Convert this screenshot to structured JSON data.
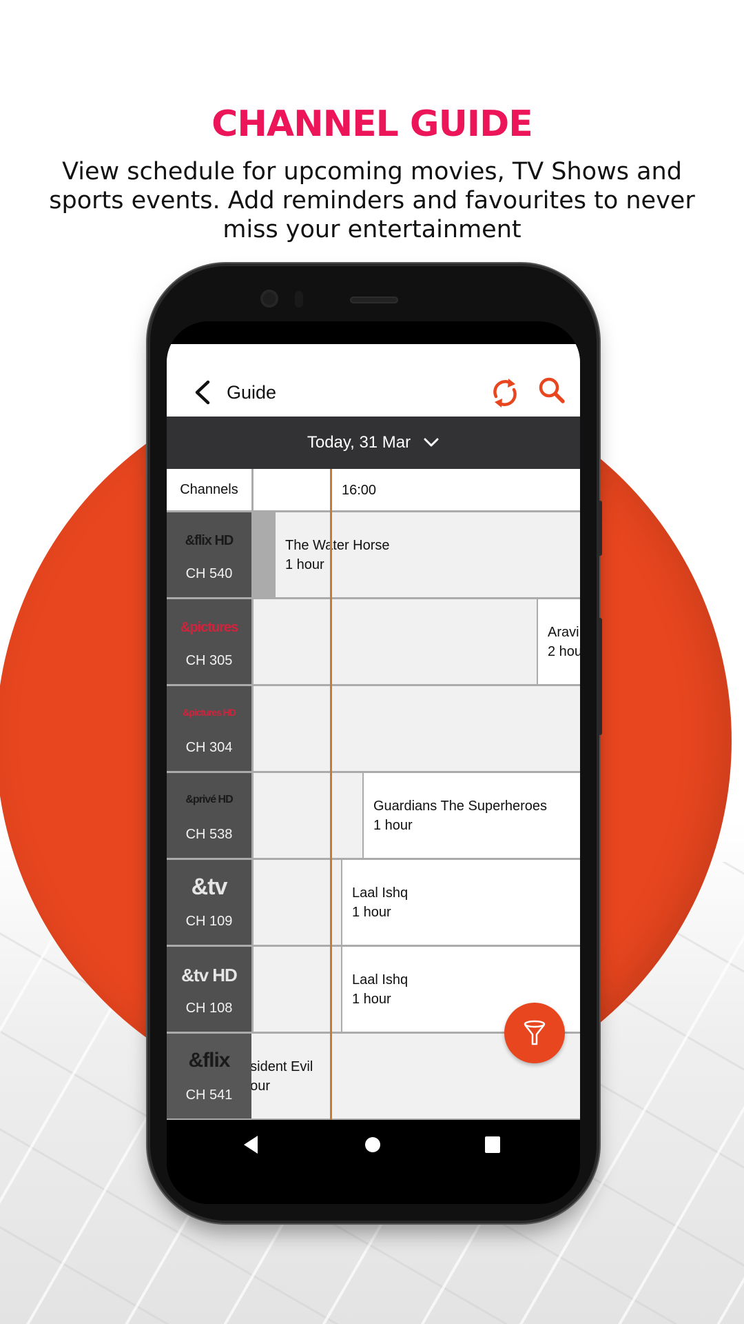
{
  "promo": {
    "headline": "CHANNEL GUIDE",
    "subtitle": "View schedule for upcoming movies, TV Shows and sports events. Add reminders and favourites to never miss your entertainment"
  },
  "colors": {
    "headline": "#ec1559",
    "accent": "#e8461f",
    "circle": "#e8461f",
    "now_line": "#c97a2c",
    "date_bar": "#323234"
  },
  "app": {
    "title": "Guide",
    "icons": {
      "back": "chevron-left-icon",
      "refresh": "refresh-icon",
      "search": "search-icon",
      "filter": "filter-funnel-icon"
    },
    "date_selector": {
      "label": "Today, 31 Mar",
      "icon": "chevron-down-icon"
    },
    "grid": {
      "channels_header": "Channels",
      "time_slots": [
        "16:00"
      ],
      "rows": [
        {
          "logo": "&flix HD",
          "logo_color": "#1a1a1a",
          "channel": "CH 540",
          "programs": [
            {
              "title": "The Water Horse",
              "duration": "1 hour"
            }
          ]
        },
        {
          "logo": "&pictures",
          "logo_color": "#d2233c",
          "channel": "CH 305",
          "programs": [
            {
              "title": "",
              "duration": ""
            },
            {
              "title": "Aravi",
              "duration": "2 hou"
            }
          ]
        },
        {
          "logo": "&pictures HD",
          "logo_color": "#d2233c",
          "channel": "CH 304",
          "programs": [
            {
              "title": "",
              "duration": ""
            }
          ]
        },
        {
          "logo": "&privé HD",
          "logo_color": "#1a1a1a",
          "channel": "CH 538",
          "programs": [
            {
              "title": "",
              "duration": ""
            },
            {
              "title": "Guardians The Superheroes",
              "duration": "1 hour"
            }
          ]
        },
        {
          "logo": "&tv",
          "logo_color": "#e5e5e5",
          "channel": "CH 109",
          "programs": [
            {
              "title": "",
              "duration": ""
            },
            {
              "title": "Laal Ishq",
              "duration": "1 hour"
            }
          ]
        },
        {
          "logo": "&tv HD",
          "logo_color": "#e5e5e5",
          "channel": "CH 108",
          "programs": [
            {
              "title": "",
              "duration": ""
            },
            {
              "title": "Laal Ishq",
              "duration": "1 hour"
            }
          ]
        },
        {
          "logo": "&flix",
          "logo_color": "#1a1a1a",
          "channel": "CH 541",
          "programs": [
            {
              "title": "esident Evil",
              "duration": "hour"
            },
            {
              "title": "",
              "duration": ""
            }
          ]
        }
      ]
    },
    "nav": {
      "back": "nav-back-icon",
      "home": "nav-home-icon",
      "recents": "nav-recents-icon"
    }
  }
}
